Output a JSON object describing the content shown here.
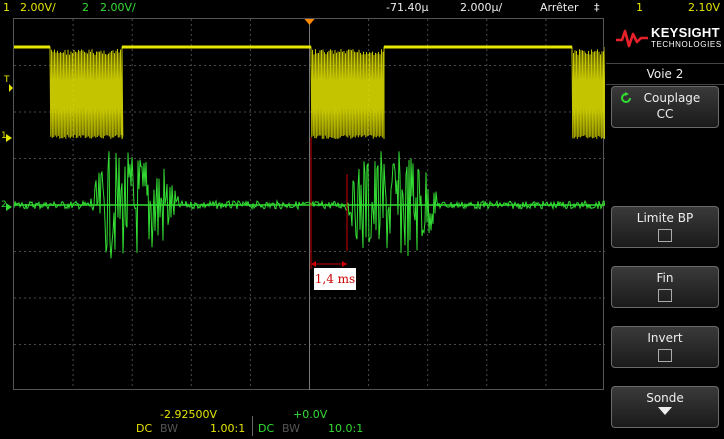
{
  "header": {
    "ch1_number": "1",
    "ch1_scale": "2.00V/",
    "ch2_number": "2",
    "ch2_scale": "2.00V/",
    "time_delay": "-71.40µ",
    "time_scale": "2.000µ/",
    "run_state": "Arrêter",
    "trigger_symbol": "‡",
    "trigger_source": "1",
    "trigger_level": "2.10V"
  },
  "brand": {
    "name": "KEYSIGHT",
    "subtitle": "TECHNOLOGIES"
  },
  "panel": {
    "title": "Voie 2",
    "coupling_label": "Couplage",
    "coupling_value": "CC",
    "bw_limit_label": "Limite BP",
    "fine_label": "Fin",
    "invert_label": "Invert",
    "probe_label": "Sonde"
  },
  "display": {
    "trigger_level_marker": "T",
    "ch1_ground_marker": "1",
    "ch2_ground_marker": "2",
    "measure_annotation": "1,4 ms"
  },
  "footer": {
    "ch1_offset": "-2.92500V",
    "ch2_offset": "+0.0V",
    "ch1_coupling": "DC",
    "ch1_bw": "BW",
    "ch1_probe": "1.00:1",
    "ch2_coupling": "DC",
    "ch2_bw": "BW",
    "ch2_probe": "10.0:1"
  },
  "colors": {
    "ch1": "#e6e600",
    "ch2": "#33dd33",
    "trigger": "#ff8a00",
    "annotation": "#cc0000",
    "grid": "#4a4a4a"
  }
}
